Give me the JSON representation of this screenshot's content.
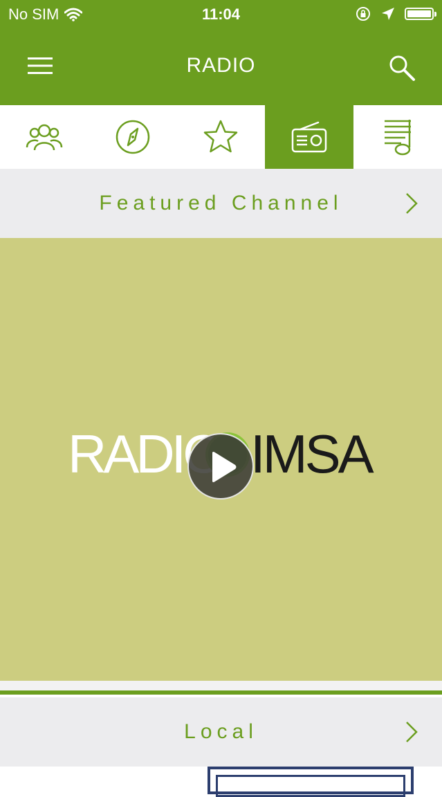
{
  "status_bar": {
    "carrier": "No SIM",
    "time": "11:04",
    "wifi_icon": "wifi-icon",
    "icons_right": [
      "orientation-lock-icon",
      "location-arrow-icon",
      "battery-icon"
    ]
  },
  "header": {
    "title": "RADIO",
    "menu_icon": "hamburger-menu-icon",
    "search_icon": "search-icon"
  },
  "tabs": [
    {
      "icon": "people-icon",
      "active": false
    },
    {
      "icon": "compass-icon",
      "active": false
    },
    {
      "icon": "star-icon",
      "active": false
    },
    {
      "icon": "radio-icon",
      "active": true
    },
    {
      "icon": "music-list-icon",
      "active": false
    }
  ],
  "sections": {
    "featured_label": "Featured Channel",
    "local_label": "Local"
  },
  "featured_channel": {
    "logo_text_left": "RADIO",
    "logo_text_right": "IMSA"
  },
  "colors": {
    "brand_green": "#6b9e1f",
    "featured_bg": "#cccd80",
    "section_bg": "#ececee"
  }
}
